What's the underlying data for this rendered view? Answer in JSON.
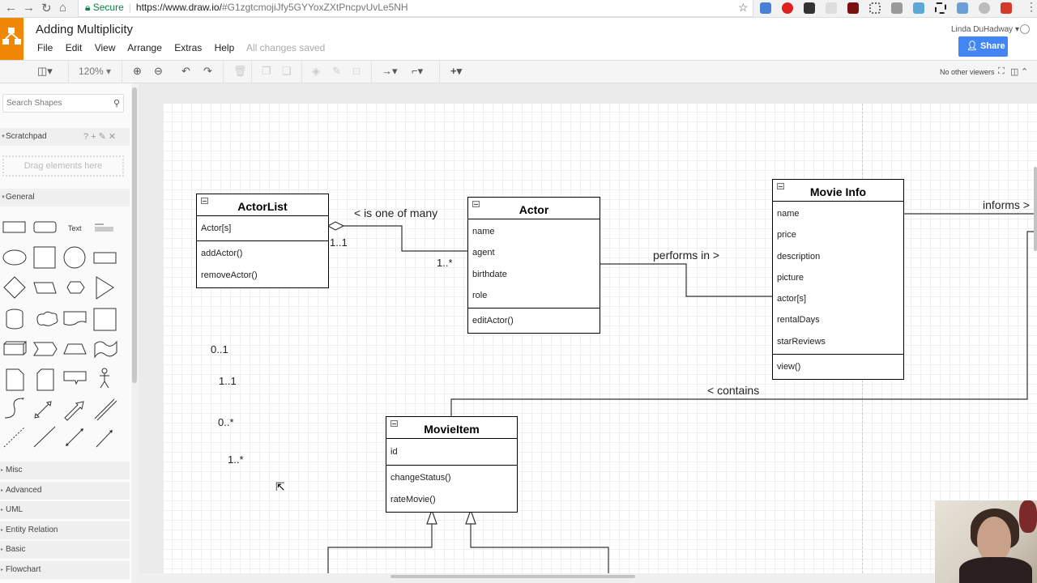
{
  "browser": {
    "address_secure_label": "Secure",
    "url_domain": "https://www.draw.io/",
    "url_hash": "#G1zgtcmojiJfy5GYYoxZXtPncpvUvLe5NH"
  },
  "app": {
    "title": "Adding Multiplicity",
    "menu": [
      "File",
      "Edit",
      "View",
      "Arrange",
      "Extras",
      "Help"
    ],
    "save_status": "All changes saved",
    "user_name": "Linda DuHadway",
    "share_label": "Share",
    "viewers_status": "No other viewers"
  },
  "toolbar": {
    "zoom_level": "120%"
  },
  "sidebar": {
    "search_placeholder": "Search Shapes",
    "scratchpad_label": "Scratchpad",
    "scratchpad_tools": "? + ✎ ✕",
    "drop_hint": "Drag elements here",
    "general_label": "General",
    "text_shape_label": "Text",
    "sections": [
      "Misc",
      "Advanced",
      "UML",
      "Entity Relation",
      "Basic",
      "Flowchart"
    ]
  },
  "diagram": {
    "classes": {
      "actorlist": {
        "name": "ActorList",
        "attributes": [
          "Actor[s]"
        ],
        "methods": [
          "addActor()",
          "removeActor()"
        ]
      },
      "actor": {
        "name": "Actor",
        "attributes": [
          "name",
          "agent",
          "birthdate",
          "role"
        ],
        "methods": [
          "editActor()"
        ]
      },
      "movieinfo": {
        "name": "Movie Info",
        "attributes": [
          "name",
          "price",
          "description",
          "picture",
          "actor[s]",
          "rentalDays",
          "starReviews"
        ],
        "methods": [
          "view()"
        ]
      },
      "movieitem": {
        "name": "MovieItem",
        "attributes": [
          "id"
        ],
        "methods": [
          "changeStatus()",
          "rateMovie()"
        ]
      }
    },
    "edge_labels": {
      "is_one_of_many": "< is one of many",
      "performs_in": "performs in >",
      "informs": "informs >",
      "contains": "< contains"
    },
    "multiplicities": {
      "actorlist_end": "1..1",
      "actor_end": "1..*"
    },
    "legend_multiplicities": [
      "0..1",
      "1..1",
      "0..*",
      "1..*"
    ]
  }
}
